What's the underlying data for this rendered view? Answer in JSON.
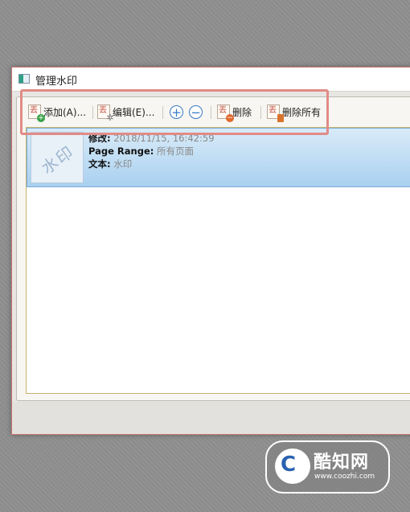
{
  "window": {
    "title": "管理水印"
  },
  "toolbar": {
    "add_label": "添加(A)...",
    "edit_label": "编辑(E)...",
    "delete_label": "删除",
    "delete_all_label": "删除所有"
  },
  "list": {
    "items": [
      {
        "thumbnail_text": "水印",
        "modified_label": "修改:",
        "modified_value": "2018/11/15, 16:42:59",
        "page_range_label": "Page Range:",
        "page_range_value": "所有页面",
        "text_label": "文本:",
        "text_value": "水印"
      }
    ]
  },
  "overlay": {
    "brand_cn": "酷知网",
    "brand_url": "www.coozhi.com",
    "highlight_color": "#e28b87"
  },
  "icons": [
    "app-icon",
    "add-watermark-icon",
    "edit-watermark-icon",
    "zoom-in-icon",
    "zoom-out-icon",
    "delete-watermark-icon",
    "delete-all-icon"
  ]
}
